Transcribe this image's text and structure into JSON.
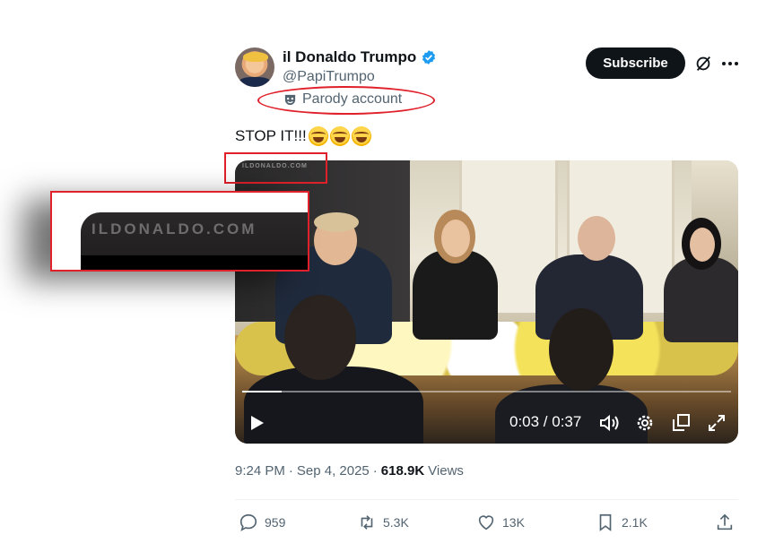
{
  "author": {
    "display_name": "il Donaldo Trumpo",
    "handle": "@PapiTrumpo",
    "parody_label": "Parody account"
  },
  "header_actions": {
    "subscribe_label": "Subscribe",
    "grok_icon": "grok-icon",
    "more_icon": "more-icon"
  },
  "tweet": {
    "text": "STOP IT!!!",
    "emoji": [
      "rolling-on-floor-laughing",
      "rolling-on-floor-laughing",
      "rolling-on-floor-laughing"
    ]
  },
  "video": {
    "watermark": "ILDONALDO.COM",
    "time_display": "0:03 / 0:37",
    "progress": 0.081
  },
  "zoom_callout": {
    "text": "ILDONALDO.COM"
  },
  "meta": {
    "time": "9:24 PM",
    "sep1": "·",
    "date": "Sep 4, 2025",
    "sep2": "·",
    "views_count": "618.9K",
    "views_label": "Views"
  },
  "actions": {
    "replies": "959",
    "reposts": "5.3K",
    "likes": "13K",
    "bookmarks": "2.1K"
  },
  "colors": {
    "accent": "#1d9bf0",
    "annotation_red": "#e0202a",
    "text_primary": "#0f1419",
    "text_secondary": "#536471"
  }
}
